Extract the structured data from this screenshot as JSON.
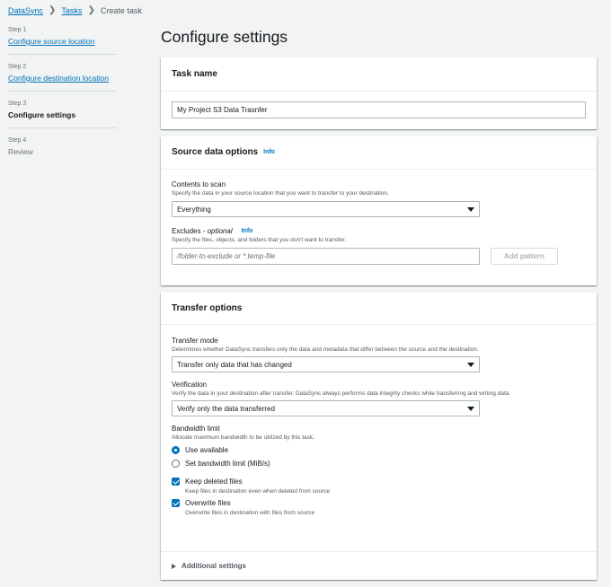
{
  "breadcrumb": {
    "items": [
      "DataSync",
      "Tasks"
    ],
    "current": "Create task"
  },
  "steps": [
    {
      "num": "Step 1",
      "label": "Configure source location"
    },
    {
      "num": "Step 2",
      "label": "Configure destination location"
    },
    {
      "num": "Step 3",
      "label": "Configure settings"
    },
    {
      "num": "Step 4",
      "label": "Review"
    }
  ],
  "page": {
    "title": "Configure settings"
  },
  "task_name": {
    "header": "Task name",
    "value": "My Project  S3 Data Trasnfer"
  },
  "source_options": {
    "header": "Source data options",
    "info": "Info",
    "contents_label": "Contents to scan",
    "contents_desc": "Specify the data in your source location that you want to transfer to your destination.",
    "contents_value": "Everything",
    "excludes_label": "Excludes - ",
    "excludes_optional": "optional",
    "excludes_info": "Info",
    "excludes_desc": "Specify the files, objects, and folders that you don't want to transfer.",
    "excludes_placeholder": "/folder-to-exclude or *.temp-file",
    "add_pattern": "Add pattern"
  },
  "transfer_options": {
    "header": "Transfer options",
    "mode_label": "Transfer mode",
    "mode_desc": "Determines whether DataSync transfers only the data and metadata that differ between the source and the destination.",
    "mode_value": "Transfer only data that has changed",
    "verify_label": "Verification",
    "verify_desc": "Verify the data in your destination after transfer. DataSync always performs data integrity checks while transferring and writing data.",
    "verify_value": "Verify only the data transferred",
    "bw_label": "Bandwidth limit",
    "bw_desc": "Allocate maximum bandwidth to be utilized by this task.",
    "bw_opt1": "Use available",
    "bw_opt2": "Set bandwidth limit (MiB/s)",
    "keep_label": "Keep deleted files",
    "keep_desc": "Keep files in destination even when deleted from source",
    "overwrite_label": "Overwrite files",
    "overwrite_desc": "Overwrite files in destination with files from source",
    "additional": "Additional settings"
  },
  "colors": {
    "link": "#0073bb",
    "background": "#f2f3f3"
  }
}
